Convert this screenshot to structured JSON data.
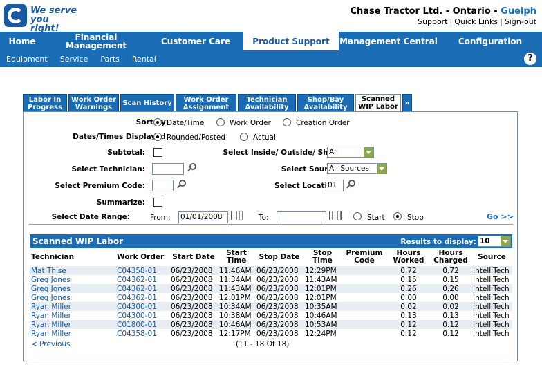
{
  "brand": {
    "tagline_line1": "We serve",
    "tagline_line2": "you right!"
  },
  "company": {
    "name": "Chase Tractor Ltd. - Ontario - ",
    "city": "Guelph"
  },
  "toplinks": [
    "Support",
    "Quick Links",
    "Sign-out"
  ],
  "mainnav": [
    "Home",
    "Financial Management",
    "Customer Care",
    "Product Support",
    "Management Central",
    "Configuration"
  ],
  "subnav": [
    "Equipment",
    "Service",
    "Parts",
    "Rental"
  ],
  "help_label": "?",
  "tabs": [
    "Labor In Progress",
    "Work Order Warnings",
    "Scan History",
    "Work Order Assignment",
    "Technician Availability",
    "Shop/Bay Availability",
    "Scanned WIP Labor",
    "»"
  ],
  "form": {
    "sort_by_label": "Sort by:",
    "sort_options": [
      "Date/Time",
      "Work Order",
      "Creation Order"
    ],
    "dates_label": "Dates/Times Displayed:",
    "dates_options": [
      "Rounded/Posted",
      "Actual"
    ],
    "subtotal_label": "Subtotal:",
    "inside_label": "Select Inside/ Outside/ Shift:",
    "inside_value": "All",
    "technician_label": "Select Technician:",
    "source_label": "Select Source:",
    "source_value": "All Sources",
    "premium_label": "Select Premium Code:",
    "location_label": "Select Location:",
    "location_value": "01",
    "summarize_label": "Summarize:",
    "date_range_label": "Select Date Range:",
    "from_label": "From:",
    "from_value": "01/01/2008",
    "to_label": "To:",
    "to_value": "",
    "start_label": "Start",
    "stop_label": "Stop",
    "go_label": "Go >>"
  },
  "wip": {
    "title": "Scanned WIP Labor",
    "results_label": "Results to display:",
    "results_value": "10",
    "columns": [
      "Technician",
      "Work Order",
      "Start Date",
      "Start Time",
      "Stop Date",
      "Stop Time",
      "Premium Code",
      "Hours Worked",
      "Hours Charged",
      "Source"
    ],
    "rows": [
      [
        "Mat Thise",
        "C04358-01",
        "06/23/2008",
        "11:46AM",
        "06/23/2008",
        "12:29PM",
        "",
        "0.72",
        "0.72",
        "IntelliTech"
      ],
      [
        "Greg Jones",
        "C04362-01",
        "06/23/2008",
        "11:34AM",
        "06/23/2008",
        "11:43AM",
        "",
        "0.15",
        "0.15",
        "IntelliTech"
      ],
      [
        "Greg Jones",
        "C04362-01",
        "06/23/2008",
        "11:43AM",
        "06/23/2008",
        "12:01PM",
        "",
        "0.26",
        "0.26",
        "IntelliTech"
      ],
      [
        "Greg Jones",
        "C04362-01",
        "06/23/2008",
        "12:01PM",
        "06/23/2008",
        "12:01PM",
        "",
        "0.00",
        "0.00",
        "IntelliTech"
      ],
      [
        "Ryan Miller",
        "C04300-01",
        "06/23/2008",
        "10:34AM",
        "06/23/2008",
        "10:35AM",
        "",
        "0.02",
        "0.02",
        "IntelliTech"
      ],
      [
        "Ryan Miller",
        "C04300-01",
        "06/23/2008",
        "10:38AM",
        "06/23/2008",
        "10:46AM",
        "",
        "0.13",
        "0.13",
        "IntelliTech"
      ],
      [
        "Ryan Miller",
        "C01800-01",
        "06/23/2008",
        "10:46AM",
        "06/23/2008",
        "10:53AM",
        "",
        "0.12",
        "0.12",
        "IntelliTech"
      ],
      [
        "Ryan Miller",
        "C04358-01",
        "06/23/2008",
        "12:17PM",
        "06/23/2008",
        "12:24PM",
        "",
        "0.12",
        "0.12",
        "IntelliTech"
      ]
    ],
    "prev_label": "< Previous",
    "range_label": "(11  -  18  Of  18)"
  }
}
